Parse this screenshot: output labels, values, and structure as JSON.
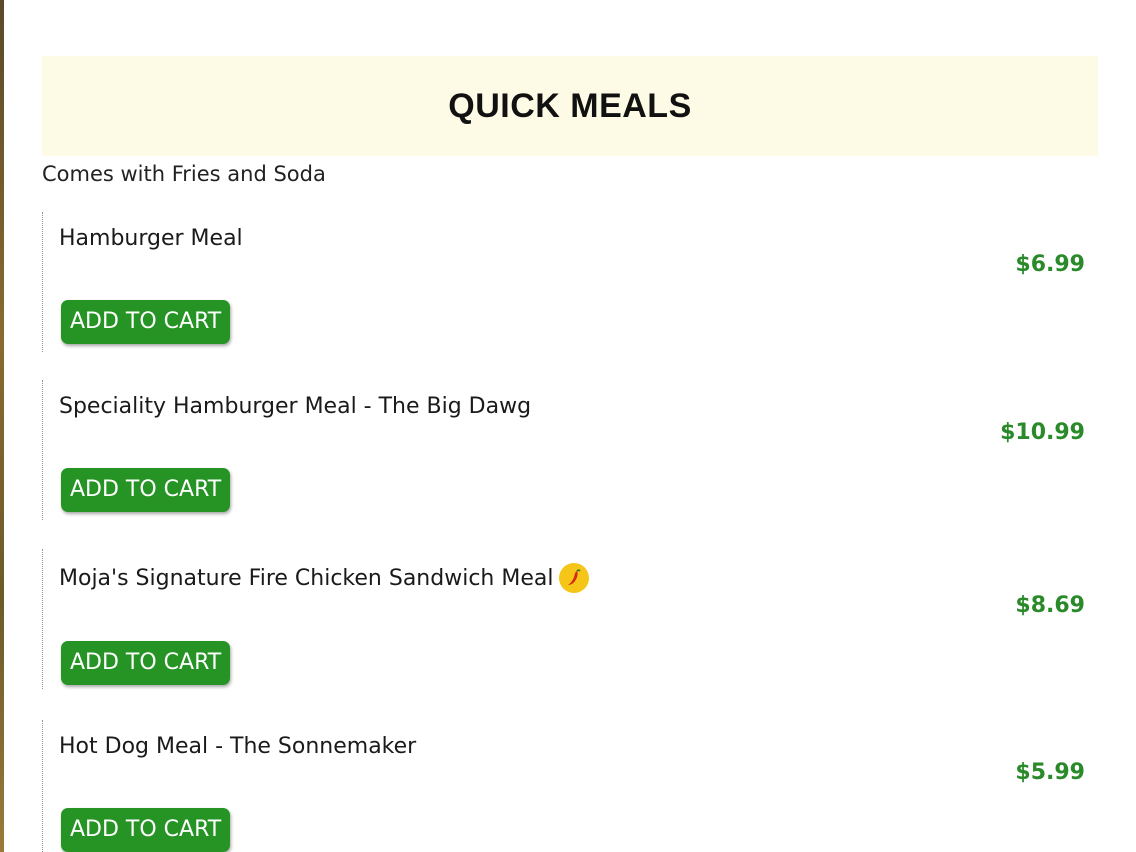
{
  "section": {
    "title": "QUICK MEALS",
    "subtitle": "Comes with Fries and Soda"
  },
  "items": [
    {
      "name": "Hamburger Meal",
      "price": "$6.99",
      "button_label": "ADD TO CART",
      "spicy": false
    },
    {
      "name": "Speciality Hamburger Meal - The Big Dawg",
      "price": "$10.99",
      "button_label": "ADD TO CART",
      "spicy": false
    },
    {
      "name": "Moja's Signature Fire Chicken Sandwich Meal",
      "price": "$8.69",
      "button_label": "ADD TO CART",
      "spicy": true,
      "badge_icon": "chili-pepper-icon"
    },
    {
      "name": "Hot Dog Meal - The Sonnemaker",
      "price": "$5.99",
      "button_label": "ADD TO CART",
      "spicy": false
    }
  ],
  "colors": {
    "button_bg": "#259425",
    "price": "#2a8a2a",
    "header_bg": "#fdfbe6",
    "spicy_badge": "#f5c518"
  }
}
